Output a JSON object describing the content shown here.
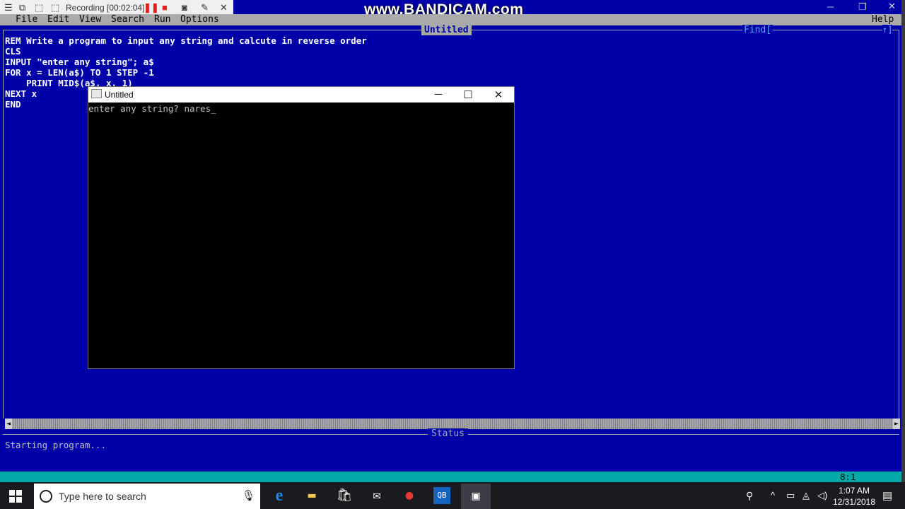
{
  "recorder": {
    "status": "Recording [00:02:04]",
    "watermark": "www.BANDICAM.com"
  },
  "menu": {
    "file": "File",
    "edit": "Edit",
    "view": "View",
    "search": "Search",
    "run": "Run",
    "options": "Options",
    "help": "Help"
  },
  "editor": {
    "title": "Untitled",
    "find": "Find[",
    "arrows": "↑]",
    "lines": [
      "REM Write a program to input any string and calcute in reverse order",
      "CLS",
      "INPUT \"enter any string\"; a$",
      "FOR x = LEN(a$) TO 1 STEP -1",
      "    PRINT MID$(a$, x, 1)",
      "NEXT x",
      "END"
    ]
  },
  "status": {
    "title": "Status",
    "text": "Starting program...",
    "position": "8:1"
  },
  "output_window": {
    "title": "Untitled",
    "text": "enter any string? nares_"
  },
  "taskbar": {
    "search_placeholder": "Type here to search",
    "time": "1:07 AM",
    "date": "12/31/2018"
  },
  "colors": {
    "qbasic_blue": "#0000a8",
    "menu_gray": "#ababab",
    "status_cyan": "#00a8a8",
    "recording_red": "#e02020"
  }
}
